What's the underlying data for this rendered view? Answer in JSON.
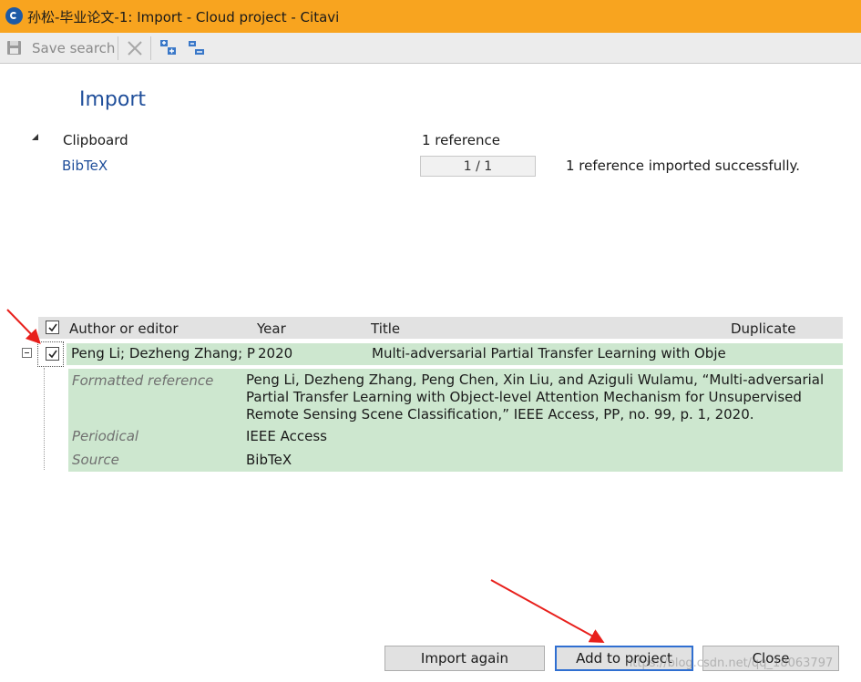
{
  "window": {
    "title": "孙松-毕业论文-1: Import - Cloud project - Citavi",
    "accent_color": "#f8a41f",
    "app_icon": "citavi-logo-icon"
  },
  "toolbar": {
    "save_search_label": "Save search",
    "save_icon": "floppy-disk-icon",
    "delete_icon": "close-icon",
    "expand_icon": "expand-tree-icon",
    "collapse_icon": "collapse-tree-icon"
  },
  "import": {
    "heading": "Import",
    "source_group": "Clipboard",
    "source_group_count": "1 reference",
    "source_item": "BibTeX",
    "progress_text": "1 / 1",
    "progress_fraction": 1.0,
    "status": "1 reference imported successfully."
  },
  "table": {
    "columns": [
      "Author or editor",
      "Year",
      "Title",
      "Duplicate"
    ],
    "header_checked": true,
    "rows": [
      {
        "checked": true,
        "expanded": true,
        "author": "Peng Li; Dezheng Zhang; P",
        "year": "2020",
        "title": "Multi-adversarial Partial Transfer Learning with Obje",
        "duplicate": "",
        "details": {
          "formatted_reference_label": "Formatted reference",
          "formatted_reference_lines": [
            "Peng Li, Dezheng Zhang, Peng Chen, Xin Liu, and Aziguli Wulamu, “Multi-adversarial",
            "Partial Transfer Learning with Object-level Attention Mechanism for Unsupervised",
            "Remote Sensing Scene Classification,” IEEE Access, PP, no. 99, p. 1, 2020."
          ],
          "periodical_label": "Periodical",
          "periodical_value": "IEEE Access",
          "source_label": "Source",
          "source_value": "BibTeX"
        }
      }
    ],
    "row_highlight_color": "#cde7cf"
  },
  "buttons": {
    "import_again": "Import again",
    "add_to_project": "Add to project",
    "close": "Close"
  },
  "watermark": "https://blog.csdn.net/qq_18063797",
  "annotation_color": "#e8201c"
}
